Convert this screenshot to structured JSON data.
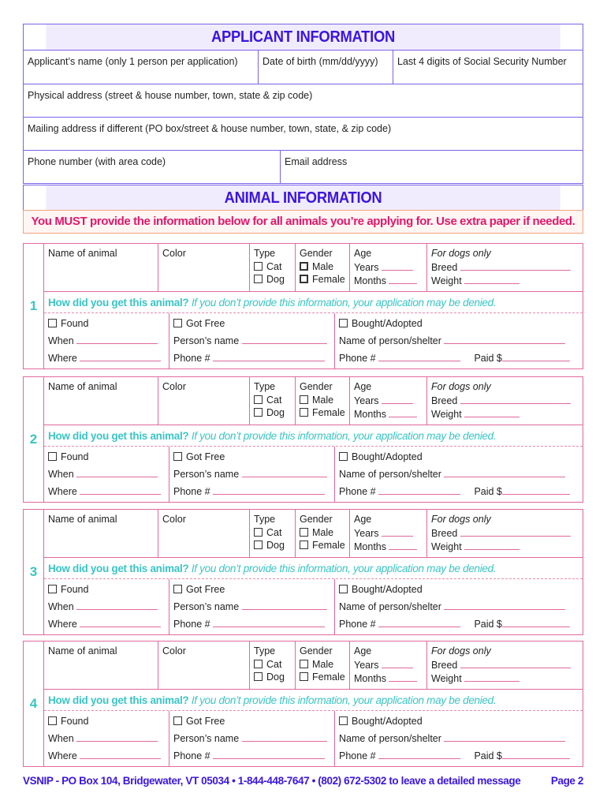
{
  "applicant_section": {
    "title": "APPLICANT INFORMATION",
    "fields": {
      "name": "Applicant’s name (only 1 person per application)",
      "dob": "Date of birth (mm/dd/yyyy)",
      "ssn": "Last 4 digits of Social Security Number",
      "physical_address": "Physical address (street & house number, town, state & zip code)",
      "mailing_address": "Mailing address if different (PO box/street & house number, town, state, & zip code)",
      "phone": "Phone number (with area code)",
      "email": "Email address"
    }
  },
  "animal_section": {
    "title": "ANIMAL INFORMATION",
    "notice": "You MUST provide the information below for all animals you’re applying for. Use extra paper if needed.",
    "labels": {
      "name": "Name of animal",
      "color": "Color",
      "type": "Type",
      "cat": "Cat",
      "dog": "Dog",
      "gender": "Gender",
      "male": "Male",
      "female": "Female",
      "age": "Age",
      "years": "Years",
      "months": "Months",
      "dogs_only": "For dogs only",
      "breed": "Breed",
      "weight": "Weight",
      "how_q": "How did you get this animal?",
      "how_warn": "If you don’t provide this information, your application may be denied.",
      "found": "Found",
      "when": "When",
      "where": "Where",
      "got_free": "Got Free",
      "persons_name": "Person’s name",
      "phone": "Phone #",
      "bought": "Bought/Adopted",
      "person_shelter": "Name of person/shelter",
      "paid": "Paid $"
    },
    "animals": [
      {
        "number": "1"
      },
      {
        "number": "2"
      },
      {
        "number": "3"
      },
      {
        "number": "4"
      }
    ]
  },
  "footer": {
    "contact": "VSNIP - PO Box 104, Bridgewater, VT  05034  •  1-844-448-7647  •  (802) 672-5302 to leave a detailed message",
    "page": "Page 2"
  },
  "colors": {
    "heading": "#3a16e0",
    "applicant_border": "#7b63e6",
    "animal_border": "#e0699e",
    "notice_text": "#e0186c",
    "accent_teal": "#3cc4c4"
  }
}
